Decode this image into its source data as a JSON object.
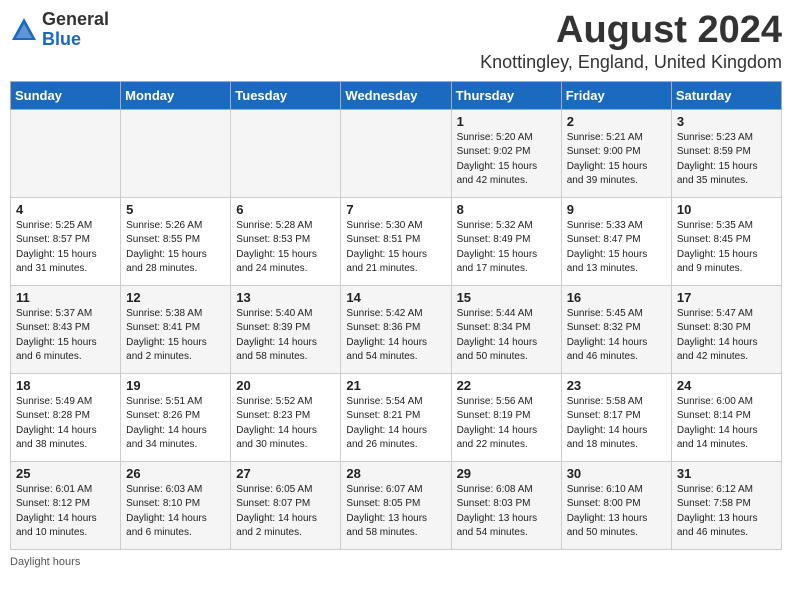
{
  "header": {
    "logo_general": "General",
    "logo_blue": "Blue",
    "month_title": "August 2024",
    "location": "Knottingley, England, United Kingdom"
  },
  "days_of_week": [
    "Sunday",
    "Monday",
    "Tuesday",
    "Wednesday",
    "Thursday",
    "Friday",
    "Saturday"
  ],
  "weeks": [
    [
      {
        "day": "",
        "info": ""
      },
      {
        "day": "",
        "info": ""
      },
      {
        "day": "",
        "info": ""
      },
      {
        "day": "",
        "info": ""
      },
      {
        "day": "1",
        "info": "Sunrise: 5:20 AM\nSunset: 9:02 PM\nDaylight: 15 hours\nand 42 minutes."
      },
      {
        "day": "2",
        "info": "Sunrise: 5:21 AM\nSunset: 9:00 PM\nDaylight: 15 hours\nand 39 minutes."
      },
      {
        "day": "3",
        "info": "Sunrise: 5:23 AM\nSunset: 8:59 PM\nDaylight: 15 hours\nand 35 minutes."
      }
    ],
    [
      {
        "day": "4",
        "info": "Sunrise: 5:25 AM\nSunset: 8:57 PM\nDaylight: 15 hours\nand 31 minutes."
      },
      {
        "day": "5",
        "info": "Sunrise: 5:26 AM\nSunset: 8:55 PM\nDaylight: 15 hours\nand 28 minutes."
      },
      {
        "day": "6",
        "info": "Sunrise: 5:28 AM\nSunset: 8:53 PM\nDaylight: 15 hours\nand 24 minutes."
      },
      {
        "day": "7",
        "info": "Sunrise: 5:30 AM\nSunset: 8:51 PM\nDaylight: 15 hours\nand 21 minutes."
      },
      {
        "day": "8",
        "info": "Sunrise: 5:32 AM\nSunset: 8:49 PM\nDaylight: 15 hours\nand 17 minutes."
      },
      {
        "day": "9",
        "info": "Sunrise: 5:33 AM\nSunset: 8:47 PM\nDaylight: 15 hours\nand 13 minutes."
      },
      {
        "day": "10",
        "info": "Sunrise: 5:35 AM\nSunset: 8:45 PM\nDaylight: 15 hours\nand 9 minutes."
      }
    ],
    [
      {
        "day": "11",
        "info": "Sunrise: 5:37 AM\nSunset: 8:43 PM\nDaylight: 15 hours\nand 6 minutes."
      },
      {
        "day": "12",
        "info": "Sunrise: 5:38 AM\nSunset: 8:41 PM\nDaylight: 15 hours\nand 2 minutes."
      },
      {
        "day": "13",
        "info": "Sunrise: 5:40 AM\nSunset: 8:39 PM\nDaylight: 14 hours\nand 58 minutes."
      },
      {
        "day": "14",
        "info": "Sunrise: 5:42 AM\nSunset: 8:36 PM\nDaylight: 14 hours\nand 54 minutes."
      },
      {
        "day": "15",
        "info": "Sunrise: 5:44 AM\nSunset: 8:34 PM\nDaylight: 14 hours\nand 50 minutes."
      },
      {
        "day": "16",
        "info": "Sunrise: 5:45 AM\nSunset: 8:32 PM\nDaylight: 14 hours\nand 46 minutes."
      },
      {
        "day": "17",
        "info": "Sunrise: 5:47 AM\nSunset: 8:30 PM\nDaylight: 14 hours\nand 42 minutes."
      }
    ],
    [
      {
        "day": "18",
        "info": "Sunrise: 5:49 AM\nSunset: 8:28 PM\nDaylight: 14 hours\nand 38 minutes."
      },
      {
        "day": "19",
        "info": "Sunrise: 5:51 AM\nSunset: 8:26 PM\nDaylight: 14 hours\nand 34 minutes."
      },
      {
        "day": "20",
        "info": "Sunrise: 5:52 AM\nSunset: 8:23 PM\nDaylight: 14 hours\nand 30 minutes."
      },
      {
        "day": "21",
        "info": "Sunrise: 5:54 AM\nSunset: 8:21 PM\nDaylight: 14 hours\nand 26 minutes."
      },
      {
        "day": "22",
        "info": "Sunrise: 5:56 AM\nSunset: 8:19 PM\nDaylight: 14 hours\nand 22 minutes."
      },
      {
        "day": "23",
        "info": "Sunrise: 5:58 AM\nSunset: 8:17 PM\nDaylight: 14 hours\nand 18 minutes."
      },
      {
        "day": "24",
        "info": "Sunrise: 6:00 AM\nSunset: 8:14 PM\nDaylight: 14 hours\nand 14 minutes."
      }
    ],
    [
      {
        "day": "25",
        "info": "Sunrise: 6:01 AM\nSunset: 8:12 PM\nDaylight: 14 hours\nand 10 minutes."
      },
      {
        "day": "26",
        "info": "Sunrise: 6:03 AM\nSunset: 8:10 PM\nDaylight: 14 hours\nand 6 minutes."
      },
      {
        "day": "27",
        "info": "Sunrise: 6:05 AM\nSunset: 8:07 PM\nDaylight: 14 hours\nand 2 minutes."
      },
      {
        "day": "28",
        "info": "Sunrise: 6:07 AM\nSunset: 8:05 PM\nDaylight: 13 hours\nand 58 minutes."
      },
      {
        "day": "29",
        "info": "Sunrise: 6:08 AM\nSunset: 8:03 PM\nDaylight: 13 hours\nand 54 minutes."
      },
      {
        "day": "30",
        "info": "Sunrise: 6:10 AM\nSunset: 8:00 PM\nDaylight: 13 hours\nand 50 minutes."
      },
      {
        "day": "31",
        "info": "Sunrise: 6:12 AM\nSunset: 7:58 PM\nDaylight: 13 hours\nand 46 minutes."
      }
    ]
  ],
  "footer": {
    "daylight_hours_label": "Daylight hours"
  }
}
